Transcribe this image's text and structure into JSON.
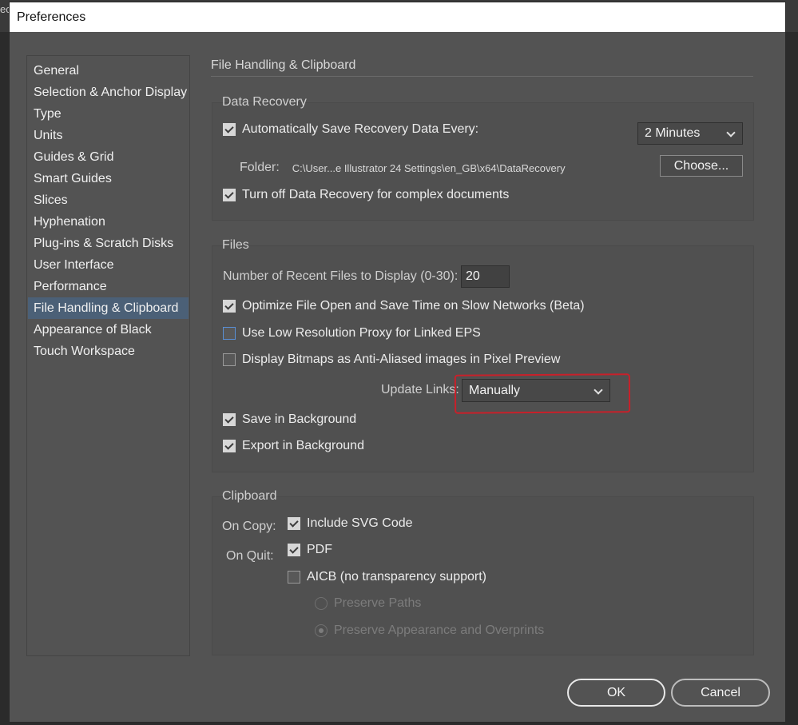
{
  "background": {
    "ghost_title": "ec"
  },
  "dialog": {
    "title": "Preferences"
  },
  "nav": {
    "items": [
      {
        "label": "General"
      },
      {
        "label": "Selection & Anchor Display"
      },
      {
        "label": "Type"
      },
      {
        "label": "Units"
      },
      {
        "label": "Guides & Grid"
      },
      {
        "label": "Smart Guides"
      },
      {
        "label": "Slices"
      },
      {
        "label": "Hyphenation"
      },
      {
        "label": "Plug-ins & Scratch Disks"
      },
      {
        "label": "User Interface"
      },
      {
        "label": "Performance"
      },
      {
        "label": "File Handling & Clipboard",
        "active": true
      },
      {
        "label": "Appearance of Black"
      },
      {
        "label": "Touch Workspace"
      }
    ]
  },
  "page": {
    "title": "File Handling & Clipboard"
  },
  "data_recovery": {
    "group_label": "Data Recovery",
    "auto_save_label": "Automatically Save Recovery Data Every:",
    "auto_save_checked": true,
    "interval_value": "2 Minutes",
    "folder_label": "Folder:",
    "folder_path": "C:\\User...e Illustrator 24 Settings\\en_GB\\x64\\DataRecovery",
    "choose_label": "Choose...",
    "turn_off_label": "Turn off Data Recovery for complex documents",
    "turn_off_checked": true
  },
  "files": {
    "group_label": "Files",
    "recent_label": "Number of Recent Files to Display (0-30):",
    "recent_value": "20",
    "optimize_label": "Optimize File Open and Save Time on Slow Networks (Beta)",
    "low_res_label": "Use Low Resolution Proxy for Linked EPS",
    "bitmaps_label": "Display Bitmaps as Anti-Aliased images in Pixel Preview",
    "update_links_label": "Update Links:",
    "update_links_value": "Manually",
    "save_bg_label": "Save in Background",
    "export_bg_label": "Export in Background"
  },
  "clipboard": {
    "group_label": "Clipboard",
    "on_copy_label": "On Copy:",
    "on_quit_label": "On Quit:",
    "svg_label": "Include SVG Code",
    "pdf_label": "PDF",
    "aicb_label": "AICB (no transparency support)",
    "preserve_paths_label": "Preserve Paths",
    "preserve_appearance_label": "Preserve Appearance and Overprints"
  },
  "footer": {
    "ok_label": "OK",
    "cancel_label": "Cancel"
  },
  "colors": {
    "accent_nav": "#4b6077",
    "annotation": "#c8202a"
  }
}
